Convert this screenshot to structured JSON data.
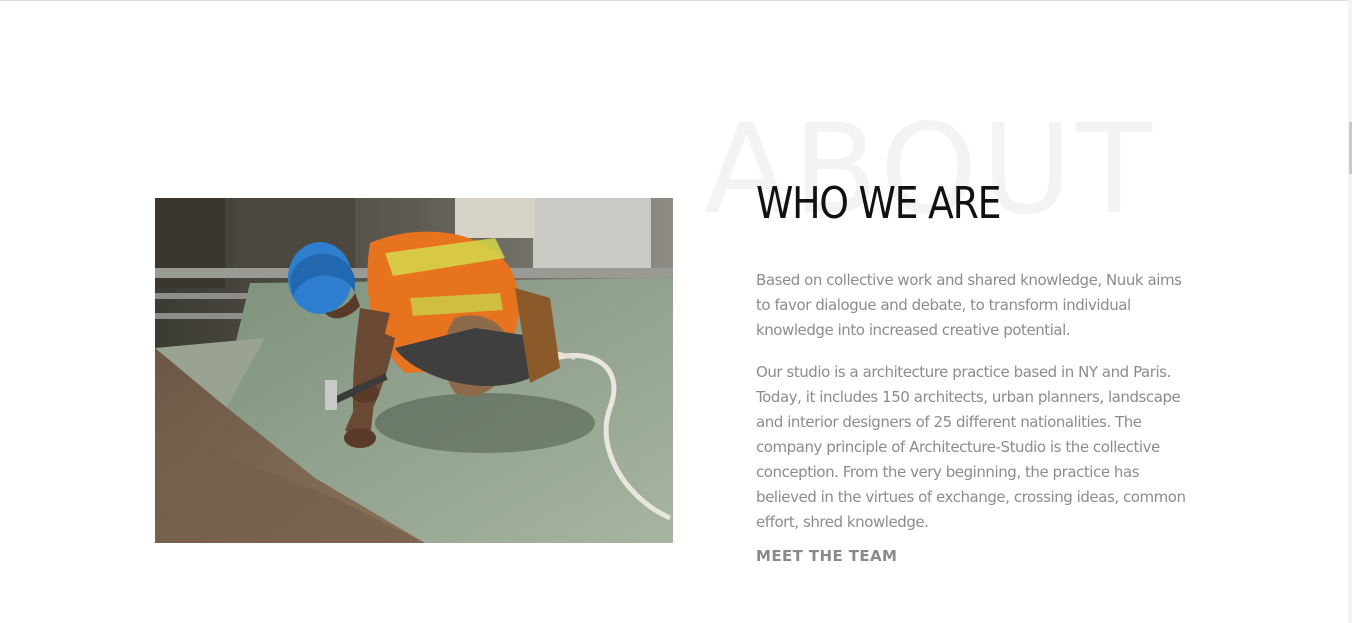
{
  "about": {
    "background_word": "ABOUT",
    "heading": "WHO WE ARE",
    "paragraph_1": "Based on collective work and shared knowledge, Nuuk aims to favor dialogue and debate, to transform individual knowledge into increased creative potential.",
    "paragraph_2": "Our studio is a architecture practice based in NY and Paris. Today, it includes 150 architects, urban planners, landscape and interior designers of 25 different nationalities. The company principle of Architecture-Studio is the collective conception. From the very beginning, the practice has believed in the virtues of exchange, crossing ideas, common effort, shred knowledge.",
    "cta_label": "MEET THE TEAM"
  },
  "colors": {
    "heading": "#111111",
    "body_text": "#8c8c8c",
    "background_word": "#f3f3f3",
    "cta": "#8a8a8a"
  }
}
